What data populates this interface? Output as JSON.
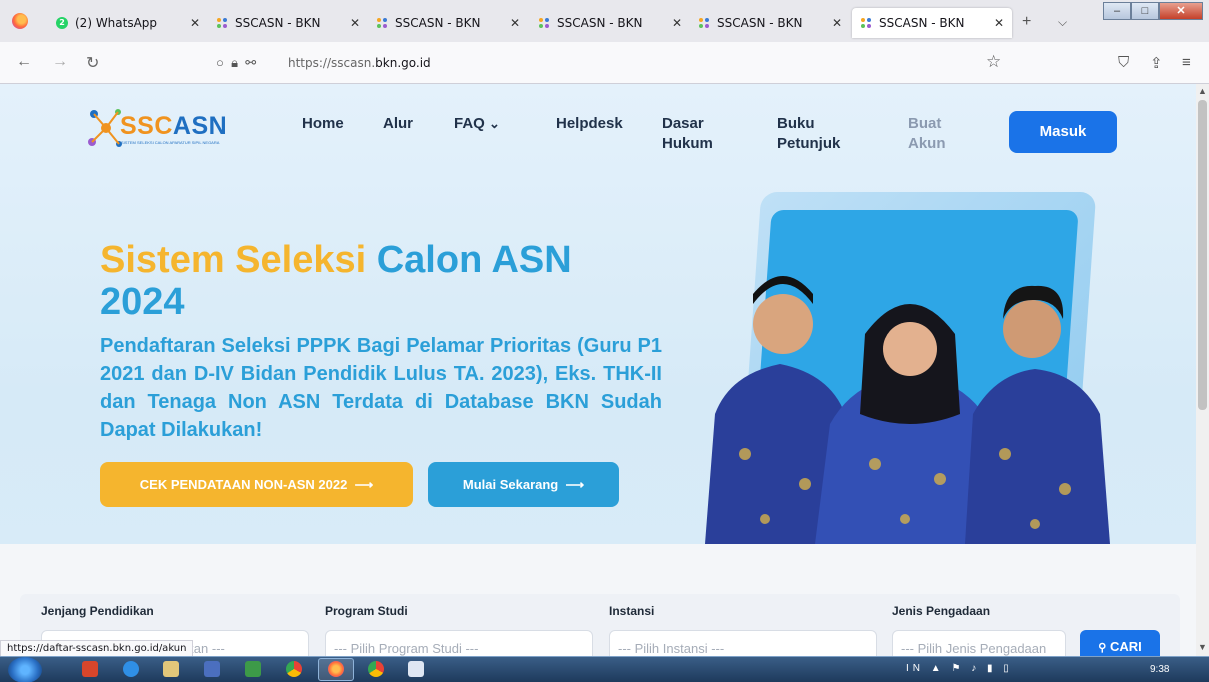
{
  "browser": {
    "tabs": [
      {
        "title": "(2) WhatsApp",
        "icon": "whatsapp-icon"
      },
      {
        "title": "SSCASN - BKN",
        "icon": "sscasn-favicon"
      },
      {
        "title": "SSCASN - BKN",
        "icon": "sscasn-favicon"
      },
      {
        "title": "SSCASN - BKN",
        "icon": "sscasn-favicon"
      },
      {
        "title": "SSCASN - BKN",
        "icon": "sscasn-favicon"
      },
      {
        "title": "SSCASN - BKN",
        "icon": "sscasn-favicon",
        "active": true
      }
    ],
    "whatsapp_badge": "2",
    "url_prefix": "https://sscasn.",
    "url_domain": "bkn.go.id",
    "status_url": "https://daftar-sscasn.bkn.go.id/akun"
  },
  "site": {
    "logo_text_a": "SSC",
    "logo_text_b": "ASN",
    "logo_sub": "SISTEM SELEKSI CALON APARATUR SIPIL NEGARA",
    "nav": {
      "home": "Home",
      "alur": "Alur",
      "faq": "FAQ",
      "helpdesk": "Helpdesk",
      "dasar_hukum_1": "Dasar",
      "dasar_hukum_2": "Hukum",
      "buku_1": "Buku",
      "buku_2": "Petunjuk",
      "buat_1": "Buat",
      "buat_2": "Akun",
      "masuk": "Masuk"
    },
    "hero": {
      "title_gold": "Sistem Seleksi",
      "title_blue": "Calon ASN",
      "title_year": "2024",
      "subtitle": "Pendaftaran Seleksi PPPK Bagi Pelamar Prioritas (Guru P1 2021 dan D-IV Bidan Pendidik Lulus TA. 2023), Eks. THK-II dan Tenaga Non ASN Terdata di Database BKN Sudah Dapat Dilakukan!",
      "btn_cek": "CEK PENDATAAN NON-ASN 2022",
      "btn_mulai": "Mulai Sekarang"
    },
    "search": {
      "jenjang_label": "Jenjang Pendidikan",
      "jenjang_placeholder": "--- Pilih Jenjang Pendidikan ---",
      "prodi_label": "Program Studi",
      "prodi_placeholder": "--- Pilih Program Studi ---",
      "instansi_label": "Instansi",
      "instansi_placeholder": "--- Pilih Instansi ---",
      "pengadaan_label": "Jenis Pengadaan",
      "pengadaan_placeholder": "--- Pilih Jenis Pengadaan",
      "cari": "CARI"
    }
  },
  "taskbar": {
    "lang": "IN",
    "clock": "9:38"
  },
  "colors": {
    "brand_blue": "#1a73e8",
    "hero_blue": "#2b9fd8",
    "hero_gold": "#f5b52e"
  }
}
